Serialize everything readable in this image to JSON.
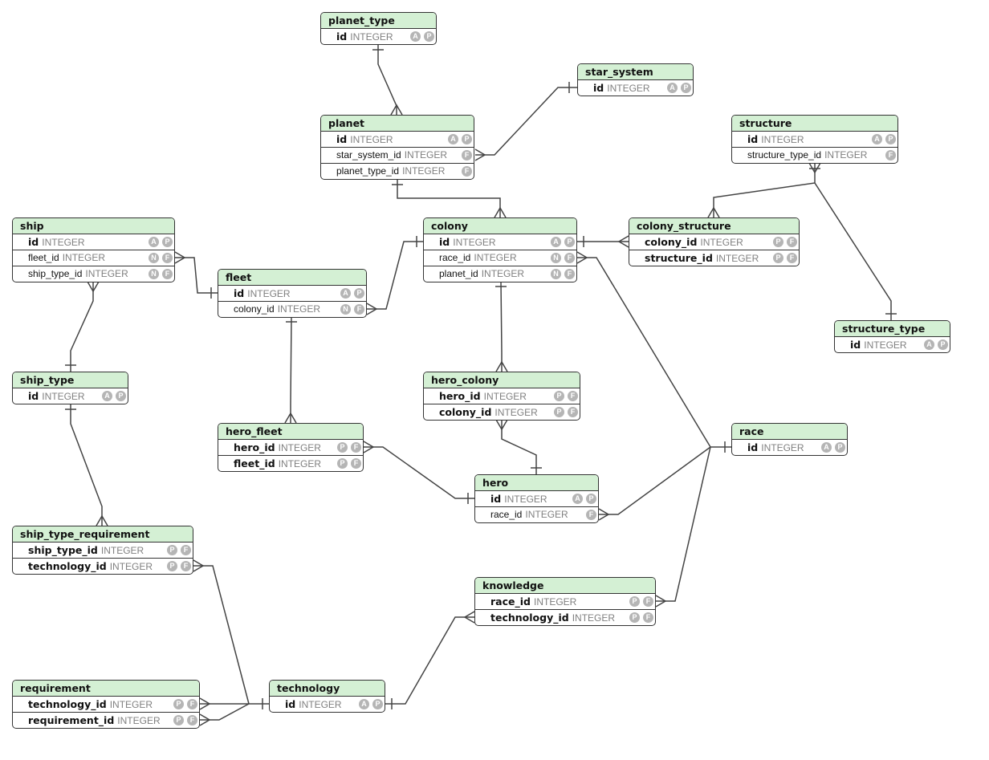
{
  "diagram": {
    "entities": [
      {
        "id": "planet_type",
        "name": "planet_type",
        "columns": [
          {
            "name": "id",
            "type": "INTEGER",
            "key": true,
            "badges": [
              "A",
              "P"
            ]
          }
        ]
      },
      {
        "id": "star_system",
        "name": "star_system",
        "columns": [
          {
            "name": "id",
            "type": "INTEGER",
            "key": true,
            "badges": [
              "A",
              "P"
            ]
          }
        ]
      },
      {
        "id": "planet",
        "name": "planet",
        "columns": [
          {
            "name": "id",
            "type": "INTEGER",
            "key": true,
            "badges": [
              "A",
              "P"
            ]
          },
          {
            "name": "star_system_id",
            "type": "INTEGER",
            "key": false,
            "badges": [
              "F"
            ]
          },
          {
            "name": "planet_type_id",
            "type": "INTEGER",
            "key": false,
            "badges": [
              "F"
            ]
          }
        ]
      },
      {
        "id": "structure",
        "name": "structure",
        "columns": [
          {
            "name": "id",
            "type": "INTEGER",
            "key": true,
            "badges": [
              "A",
              "P"
            ]
          },
          {
            "name": "structure_type_id",
            "type": "INTEGER",
            "key": false,
            "badges": [
              "F"
            ]
          }
        ]
      },
      {
        "id": "ship",
        "name": "ship",
        "columns": [
          {
            "name": "id",
            "type": "INTEGER",
            "key": true,
            "badges": [
              "A",
              "P"
            ]
          },
          {
            "name": "fleet_id",
            "type": "INTEGER",
            "key": false,
            "badges": [
              "N",
              "F"
            ]
          },
          {
            "name": "ship_type_id",
            "type": "INTEGER",
            "key": false,
            "badges": [
              "N",
              "F"
            ]
          }
        ]
      },
      {
        "id": "colony",
        "name": "colony",
        "columns": [
          {
            "name": "id",
            "type": "INTEGER",
            "key": true,
            "badges": [
              "A",
              "P"
            ]
          },
          {
            "name": "race_id",
            "type": "INTEGER",
            "key": false,
            "badges": [
              "N",
              "F"
            ]
          },
          {
            "name": "planet_id",
            "type": "INTEGER",
            "key": false,
            "badges": [
              "N",
              "F"
            ]
          }
        ]
      },
      {
        "id": "colony_structure",
        "name": "colony_structure",
        "columns": [
          {
            "name": "colony_id",
            "type": "INTEGER",
            "key": true,
            "badges": [
              "P",
              "F"
            ]
          },
          {
            "name": "structure_id",
            "type": "INTEGER",
            "key": true,
            "badges": [
              "P",
              "F"
            ]
          }
        ]
      },
      {
        "id": "fleet",
        "name": "fleet",
        "columns": [
          {
            "name": "id",
            "type": "INTEGER",
            "key": true,
            "badges": [
              "A",
              "P"
            ]
          },
          {
            "name": "colony_id",
            "type": "INTEGER",
            "key": false,
            "badges": [
              "N",
              "F"
            ]
          }
        ]
      },
      {
        "id": "structure_type",
        "name": "structure_type",
        "columns": [
          {
            "name": "id",
            "type": "INTEGER",
            "key": true,
            "badges": [
              "A",
              "P"
            ]
          }
        ]
      },
      {
        "id": "ship_type",
        "name": "ship_type",
        "columns": [
          {
            "name": "id",
            "type": "INTEGER",
            "key": true,
            "badges": [
              "A",
              "P"
            ]
          }
        ]
      },
      {
        "id": "hero_colony",
        "name": "hero_colony",
        "columns": [
          {
            "name": "hero_id",
            "type": "INTEGER",
            "key": true,
            "badges": [
              "P",
              "F"
            ]
          },
          {
            "name": "colony_id",
            "type": "INTEGER",
            "key": true,
            "badges": [
              "P",
              "F"
            ]
          }
        ]
      },
      {
        "id": "race",
        "name": "race",
        "columns": [
          {
            "name": "id",
            "type": "INTEGER",
            "key": true,
            "badges": [
              "A",
              "P"
            ]
          }
        ]
      },
      {
        "id": "hero_fleet",
        "name": "hero_fleet",
        "columns": [
          {
            "name": "hero_id",
            "type": "INTEGER",
            "key": true,
            "badges": [
              "P",
              "F"
            ]
          },
          {
            "name": "fleet_id",
            "type": "INTEGER",
            "key": true,
            "badges": [
              "P",
              "F"
            ]
          }
        ]
      },
      {
        "id": "hero",
        "name": "hero",
        "columns": [
          {
            "name": "id",
            "type": "INTEGER",
            "key": true,
            "badges": [
              "A",
              "P"
            ]
          },
          {
            "name": "race_id",
            "type": "INTEGER",
            "key": false,
            "badges": [
              "F"
            ]
          }
        ]
      },
      {
        "id": "ship_type_requirement",
        "name": "ship_type_requirement",
        "columns": [
          {
            "name": "ship_type_id",
            "type": "INTEGER",
            "key": true,
            "badges": [
              "P",
              "F"
            ]
          },
          {
            "name": "technology_id",
            "type": "INTEGER",
            "key": true,
            "badges": [
              "P",
              "F"
            ]
          }
        ]
      },
      {
        "id": "knowledge",
        "name": "knowledge",
        "columns": [
          {
            "name": "race_id",
            "type": "INTEGER",
            "key": true,
            "badges": [
              "P",
              "F"
            ]
          },
          {
            "name": "technology_id",
            "type": "INTEGER",
            "key": true,
            "badges": [
              "P",
              "F"
            ]
          }
        ]
      },
      {
        "id": "requirement",
        "name": "requirement",
        "columns": [
          {
            "name": "technology_id",
            "type": "INTEGER",
            "key": true,
            "badges": [
              "P",
              "F"
            ]
          },
          {
            "name": "requirement_id",
            "type": "INTEGER",
            "key": true,
            "badges": [
              "P",
              "F"
            ]
          }
        ]
      },
      {
        "id": "technology",
        "name": "technology",
        "columns": [
          {
            "name": "id",
            "type": "INTEGER",
            "key": true,
            "badges": [
              "A",
              "P"
            ]
          }
        ]
      }
    ],
    "relationships": [
      {
        "from": "planet.planet_type_id",
        "to": "planet_type.id",
        "cardinality": "many-to-one"
      },
      {
        "from": "planet.star_system_id",
        "to": "star_system.id",
        "cardinality": "many-to-one"
      },
      {
        "from": "colony.planet_id",
        "to": "planet.id",
        "cardinality": "many-to-one"
      },
      {
        "from": "colony_structure.structure_id",
        "to": "structure.id",
        "cardinality": "many-to-one"
      },
      {
        "from": "structure.structure_type_id",
        "to": "structure_type.id",
        "cardinality": "many-to-one"
      },
      {
        "from": "colony_structure.colony_id",
        "to": "colony.id",
        "cardinality": "many-to-one"
      },
      {
        "from": "ship.fleet_id",
        "to": "fleet.id",
        "cardinality": "many-to-one"
      },
      {
        "from": "ship.ship_type_id",
        "to": "ship_type.id",
        "cardinality": "many-to-one"
      },
      {
        "from": "fleet.colony_id",
        "to": "colony.id",
        "cardinality": "many-to-one"
      },
      {
        "from": "colony.race_id",
        "to": "race.id",
        "cardinality": "many-to-one"
      },
      {
        "from": "hero_colony.colony_id",
        "to": "colony.id",
        "cardinality": "many-to-one"
      },
      {
        "from": "hero_colony.hero_id",
        "to": "hero.id",
        "cardinality": "many-to-one"
      },
      {
        "from": "hero_fleet.fleet_id",
        "to": "fleet.id",
        "cardinality": "many-to-one"
      },
      {
        "from": "hero_fleet.hero_id",
        "to": "hero.id",
        "cardinality": "many-to-one"
      },
      {
        "from": "hero.race_id",
        "to": "race.id",
        "cardinality": "many-to-one"
      },
      {
        "from": "knowledge.race_id",
        "to": "race.id",
        "cardinality": "many-to-one"
      },
      {
        "from": "ship_type_requirement.ship_type_id",
        "to": "ship_type.id",
        "cardinality": "many-to-one"
      },
      {
        "from": "ship_type_requirement.technology_id",
        "to": "technology.id",
        "cardinality": "many-to-one"
      },
      {
        "from": "requirement.technology_id",
        "to": "technology.id",
        "cardinality": "many-to-one"
      },
      {
        "from": "requirement.requirement_id",
        "to": "technology.id",
        "cardinality": "many-to-one"
      },
      {
        "from": "knowledge.technology_id",
        "to": "technology.id",
        "cardinality": "many-to-one"
      }
    ]
  }
}
